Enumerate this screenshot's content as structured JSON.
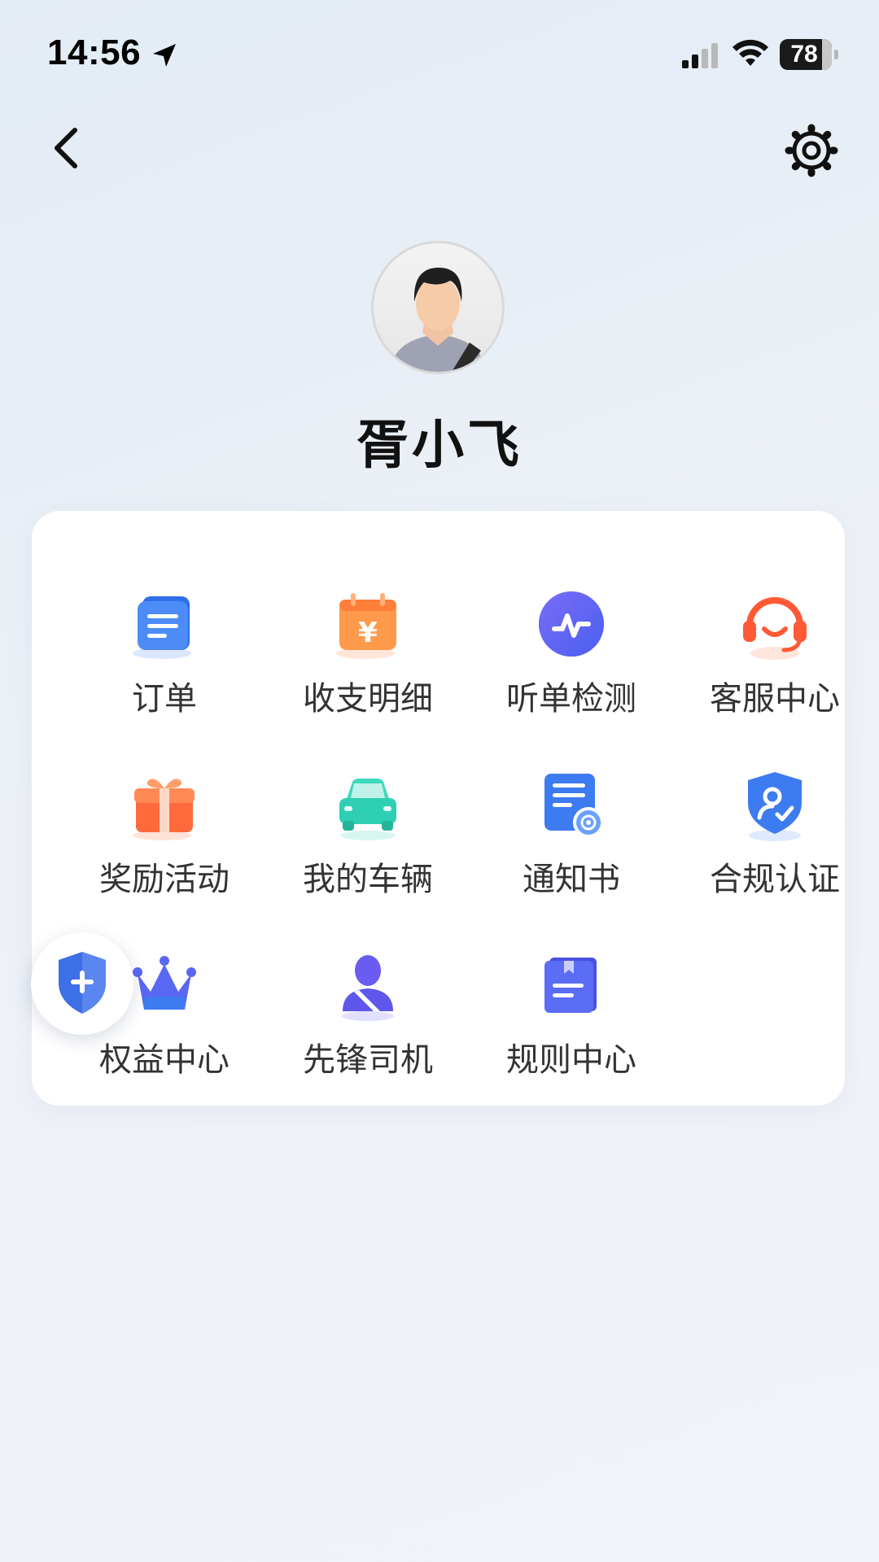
{
  "status_bar": {
    "time": "14:56",
    "battery": "78"
  },
  "profile": {
    "name": "胥小飞"
  },
  "menu": {
    "items": [
      {
        "label": "订单",
        "icon": "order-icon"
      },
      {
        "label": "收支明细",
        "icon": "income-expense-icon"
      },
      {
        "label": "听单检测",
        "icon": "order-detection-icon"
      },
      {
        "label": "客服中心",
        "icon": "customer-service-icon"
      },
      {
        "label": "奖励活动",
        "icon": "gift-icon"
      },
      {
        "label": "我的车辆",
        "icon": "car-icon"
      },
      {
        "label": "通知书",
        "icon": "notice-icon"
      },
      {
        "label": "合规认证",
        "icon": "compliance-shield-icon"
      },
      {
        "label": "权益中心",
        "icon": "crown-icon"
      },
      {
        "label": "先锋司机",
        "icon": "pioneer-driver-icon"
      },
      {
        "label": "规则中心",
        "icon": "rules-book-icon"
      }
    ]
  },
  "floating": {
    "icon": "shield-plus-icon"
  },
  "colors": {
    "accent_blue": "#3d7bf0",
    "accent_orange": "#ff7a3d",
    "accent_purple": "#6a5cf0",
    "accent_teal": "#2fd1b6"
  }
}
